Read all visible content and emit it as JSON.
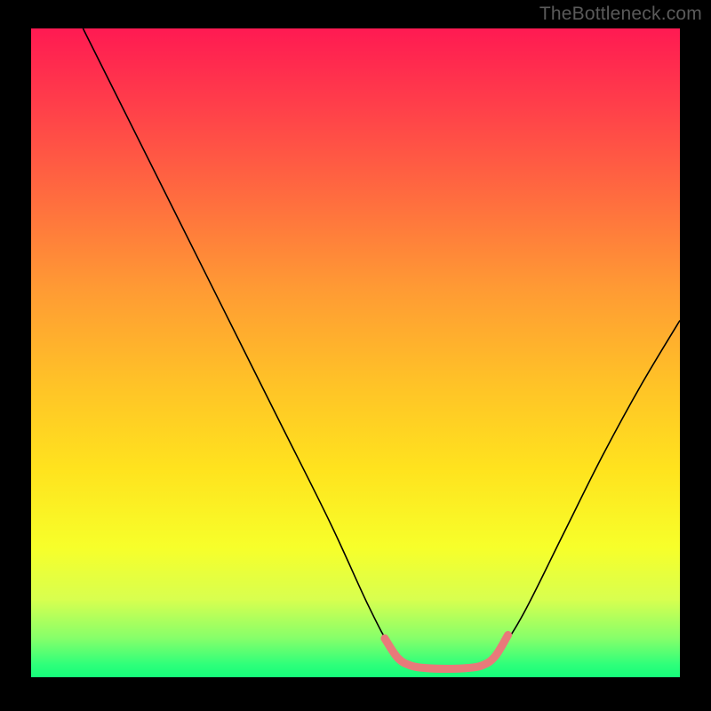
{
  "watermark": "TheBottleneck.com",
  "chart_data": {
    "type": "line",
    "title": "",
    "xlabel": "",
    "ylabel": "",
    "xlim": [
      0,
      100
    ],
    "ylim": [
      0,
      100
    ],
    "gradient_colors": {
      "top": "#ff1a52",
      "upper_mid": "#ff9a34",
      "mid": "#ffe31e",
      "lower_mid": "#d8ff4f",
      "bottom": "#15fd7a"
    },
    "series": [
      {
        "name": "curve-main",
        "color": "#000000",
        "width": 1.6,
        "points": [
          {
            "x": 8.0,
            "y": 100.0
          },
          {
            "x": 14.0,
            "y": 88.0
          },
          {
            "x": 22.0,
            "y": 72.0
          },
          {
            "x": 30.0,
            "y": 56.0
          },
          {
            "x": 38.0,
            "y": 40.0
          },
          {
            "x": 46.0,
            "y": 24.0
          },
          {
            "x": 52.0,
            "y": 11.0
          },
          {
            "x": 55.5,
            "y": 4.5
          },
          {
            "x": 58.0,
            "y": 2.0
          },
          {
            "x": 62.0,
            "y": 1.3
          },
          {
            "x": 66.0,
            "y": 1.3
          },
          {
            "x": 70.0,
            "y": 2.0
          },
          {
            "x": 72.5,
            "y": 4.5
          },
          {
            "x": 76.0,
            "y": 10.0
          },
          {
            "x": 82.0,
            "y": 22.0
          },
          {
            "x": 88.0,
            "y": 34.0
          },
          {
            "x": 94.0,
            "y": 45.0
          },
          {
            "x": 100.0,
            "y": 55.0
          }
        ]
      },
      {
        "name": "marker-segment",
        "color": "#e87a7a",
        "width": 9,
        "cap": "round",
        "points": [
          {
            "x": 54.5,
            "y": 6.0
          },
          {
            "x": 56.5,
            "y": 3.0
          },
          {
            "x": 58.5,
            "y": 1.8
          },
          {
            "x": 61.0,
            "y": 1.4
          },
          {
            "x": 64.0,
            "y": 1.3
          },
          {
            "x": 67.0,
            "y": 1.4
          },
          {
            "x": 69.5,
            "y": 1.8
          },
          {
            "x": 71.5,
            "y": 3.2
          },
          {
            "x": 73.5,
            "y": 6.5
          }
        ]
      }
    ]
  }
}
